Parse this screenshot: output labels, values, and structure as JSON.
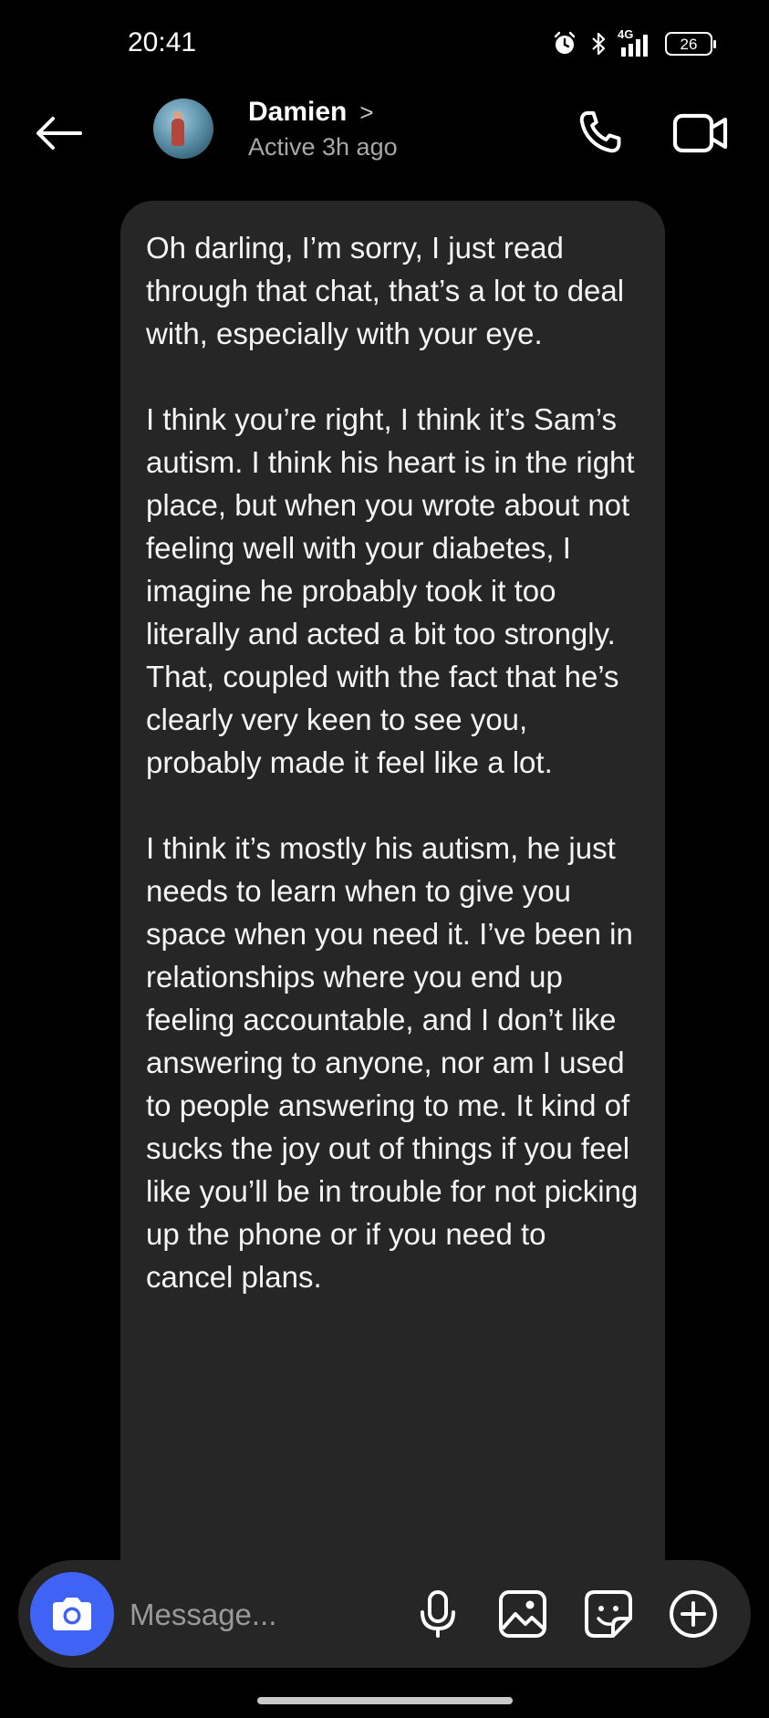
{
  "status_bar": {
    "time": "20:41",
    "network_label": "4G",
    "battery_level": "26",
    "icons": [
      "alarm-icon",
      "bluetooth-icon",
      "signal-icon",
      "battery-icon"
    ]
  },
  "header": {
    "contact_name": "Damien",
    "chevron": ">",
    "contact_status": "Active 3h ago",
    "icons": [
      "back-arrow-icon",
      "phone-icon",
      "video-camera-icon"
    ]
  },
  "message": {
    "direction": "incoming",
    "paragraphs": [
      "Oh darling, I’m sorry, I just read through that chat, that’s a lot to deal with, especially with your eye.",
      "I think you’re right, I think it’s Sam’s autism. I think his heart is in the right place, but when you wrote about not feeling well with your diabetes, I imagine he probably took it too literally and acted a bit too strongly. That, coupled with the fact that he’s clearly very keen to see you, probably made it feel like a lot.",
      "I think it’s mostly his autism, he just needs to learn when to give you space when you need it. I’ve been in relationships where you end up feeling accountable, and I don’t like answering to anyone, nor am I used to people answering to me. It kind of sucks the joy out of things if you feel like you’ll be in trouble for not picking up the phone or if you need to cancel plans."
    ]
  },
  "composer": {
    "placeholder": "Message...",
    "value": "",
    "icons": [
      "camera-icon",
      "microphone-icon",
      "gallery-icon",
      "sticker-icon",
      "plus-icon"
    ]
  },
  "colors": {
    "background": "#000000",
    "bubble": "#262626",
    "accent_camera": "#3f63f5",
    "secondary_text": "#a8a8a8"
  }
}
